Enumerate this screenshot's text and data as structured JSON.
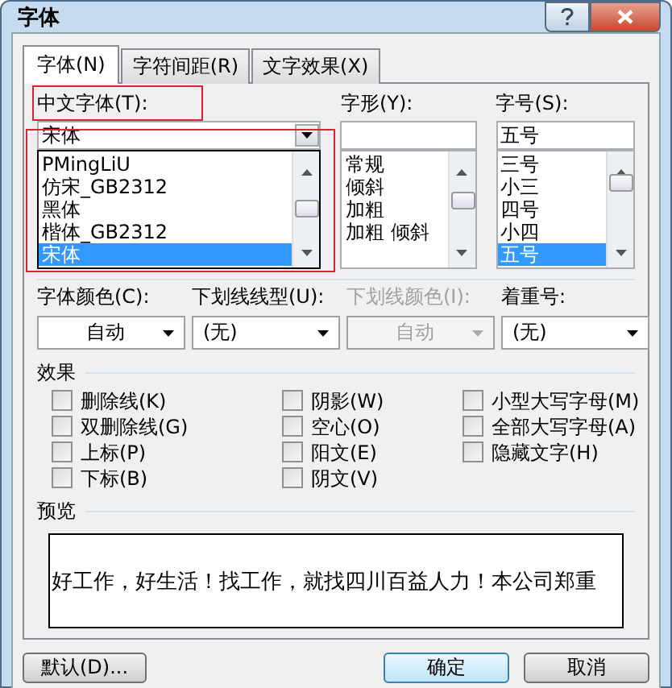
{
  "window": {
    "title": "字体"
  },
  "tabs": [
    {
      "label": "字体(N)",
      "selected": true
    },
    {
      "label": "字符间距(R)",
      "selected": false
    },
    {
      "label": "文字效果(X)",
      "selected": false
    }
  ],
  "chinese_font": {
    "label": "中文字体(T):",
    "value": "宋体",
    "options": [
      {
        "label": "PMingLiU",
        "selected": false
      },
      {
        "label": "仿宋_GB2312",
        "selected": false
      },
      {
        "label": "黑体",
        "selected": false
      },
      {
        "label": "楷体_GB2312",
        "selected": false
      },
      {
        "label": "宋体",
        "selected": true
      }
    ]
  },
  "font_style": {
    "label": "字形(Y):",
    "options": [
      {
        "label": "常规",
        "selected": false
      },
      {
        "label": "倾斜",
        "selected": false
      },
      {
        "label": "加粗",
        "selected": false
      },
      {
        "label": "加粗 倾斜",
        "selected": false
      }
    ]
  },
  "font_size": {
    "label": "字号(S):",
    "value": "五号",
    "options": [
      {
        "label": "三号",
        "selected": false
      },
      {
        "label": "小三",
        "selected": false
      },
      {
        "label": "四号",
        "selected": false
      },
      {
        "label": "小四",
        "selected": false
      },
      {
        "label": "五号",
        "selected": true
      }
    ]
  },
  "dropdowns": [
    {
      "label": "字体颜色(C):",
      "value": "自动",
      "disabled": false
    },
    {
      "label": "下划线线型(U):",
      "value": "(无)",
      "disabled": false
    },
    {
      "label": "下划线颜色(I):",
      "value": "自动",
      "disabled": true
    },
    {
      "label": "着重号:",
      "value": "(无)",
      "disabled": false
    }
  ],
  "effects": {
    "title": "效果",
    "options": [
      {
        "label": "删除线(K)",
        "checked": false
      },
      {
        "label": "阴影(W)",
        "checked": false
      },
      {
        "label": "小型大写字母(M)",
        "checked": false
      },
      {
        "label": "双删除线(G)",
        "checked": false
      },
      {
        "label": "空心(O)",
        "checked": false
      },
      {
        "label": "全部大写字母(A)",
        "checked": false
      },
      {
        "label": "上标(P)",
        "checked": false
      },
      {
        "label": "阳文(E)",
        "checked": false
      },
      {
        "label": "隐藏文字(H)",
        "checked": false
      },
      {
        "label": "下标(B)",
        "checked": false
      },
      {
        "label": "阴文(V)",
        "checked": false
      }
    ]
  },
  "preview": {
    "title": "预览",
    "text": "好工作，好生活！找工作，就找四川百益人力！本公司郑重"
  },
  "buttons": [
    {
      "label": "默认(D)...",
      "kind": "secondary"
    },
    {
      "label": "确定",
      "kind": "default"
    },
    {
      "label": "取消",
      "kind": "normal"
    }
  ]
}
